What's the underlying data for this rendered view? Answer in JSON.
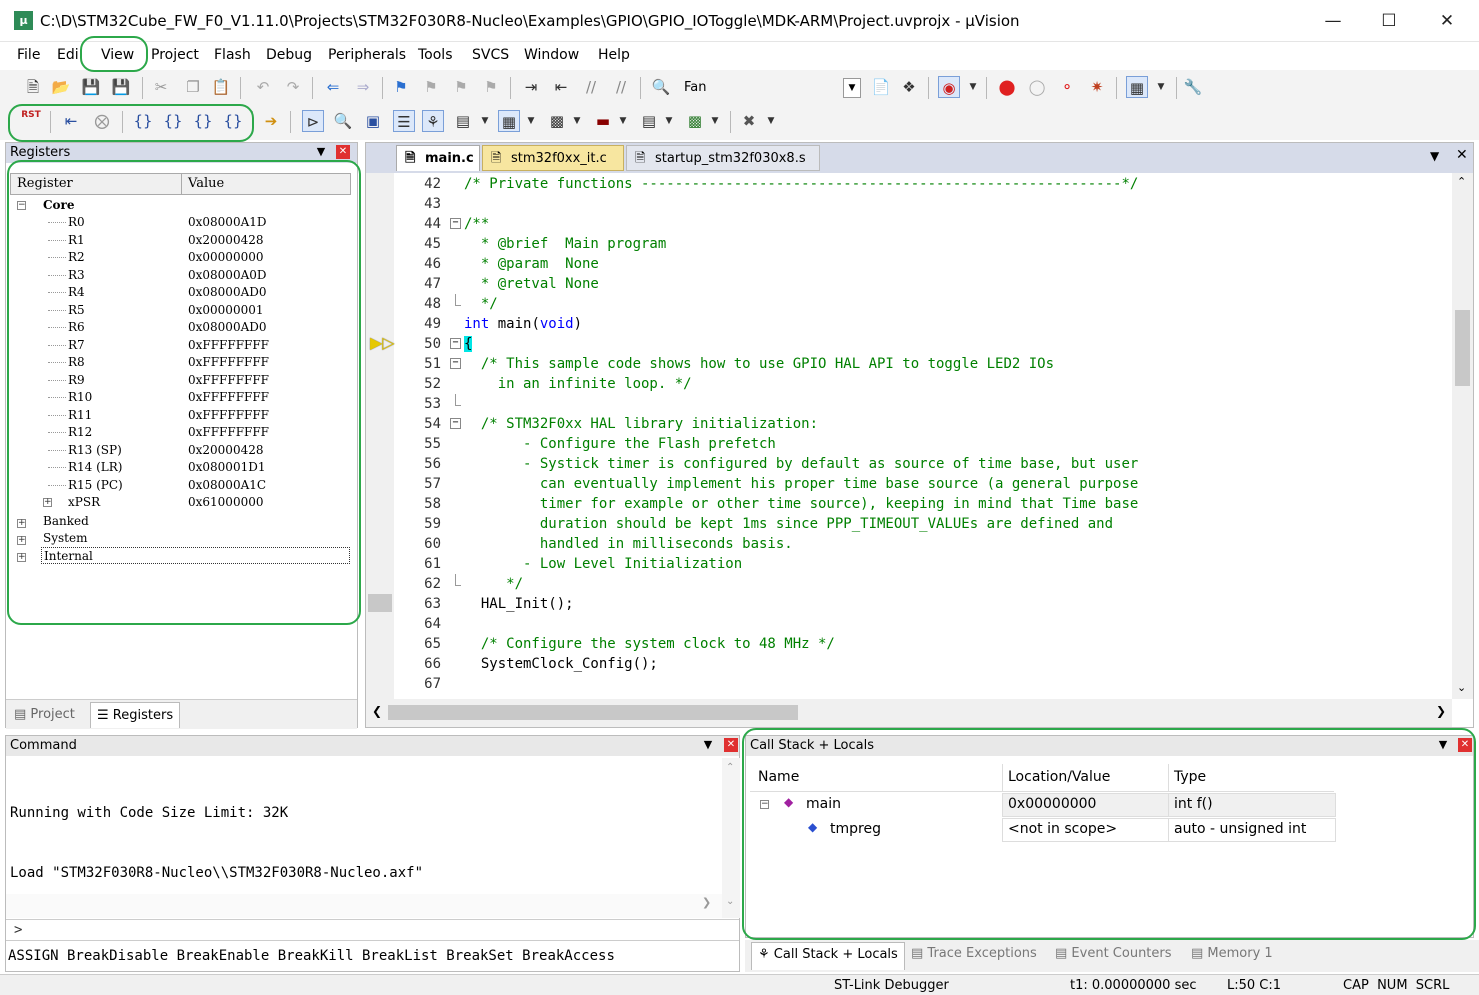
{
  "window": {
    "title": "C:\\D\\STM32Cube_FW_F0_V1.11.0\\Projects\\STM32F030R8-Nucleo\\Examples\\GPIO\\GPIO_IOToggle\\MDK-ARM\\Project.uvprojx - µVision"
  },
  "menu": [
    "File",
    "Edit",
    "View",
    "Project",
    "Flash",
    "Debug",
    "Peripherals",
    "Tools",
    "SVCS",
    "Window",
    "Help"
  ],
  "toolbar": {
    "target_name": "Fan",
    "rst_label": "RST"
  },
  "registers": {
    "title": "Registers",
    "col_register": "Register",
    "col_value": "Value",
    "core_label": "Core",
    "rows": [
      {
        "name": "R0",
        "value": "0x08000A1D"
      },
      {
        "name": "R1",
        "value": "0x20000428"
      },
      {
        "name": "R2",
        "value": "0x00000000"
      },
      {
        "name": "R3",
        "value": "0x08000A0D"
      },
      {
        "name": "R4",
        "value": "0x08000AD0"
      },
      {
        "name": "R5",
        "value": "0x00000001"
      },
      {
        "name": "R6",
        "value": "0x08000AD0"
      },
      {
        "name": "R7",
        "value": "0xFFFFFFFF"
      },
      {
        "name": "R8",
        "value": "0xFFFFFFFF"
      },
      {
        "name": "R9",
        "value": "0xFFFFFFFF"
      },
      {
        "name": "R10",
        "value": "0xFFFFFFFF"
      },
      {
        "name": "R11",
        "value": "0xFFFFFFFF"
      },
      {
        "name": "R12",
        "value": "0xFFFFFFFF"
      },
      {
        "name": "R13 (SP)",
        "value": "0x20000428"
      },
      {
        "name": "R14 (LR)",
        "value": "0x080001D1"
      },
      {
        "name": "R15 (PC)",
        "value": "0x08000A1C"
      },
      {
        "name": "xPSR",
        "value": "0x61000000"
      }
    ],
    "groups": [
      "Banked",
      "System",
      "Internal"
    ],
    "tab_project": "Project",
    "tab_registers": "Registers"
  },
  "editor": {
    "tabs": [
      "main.c",
      "stm32f0xx_it.c",
      "startup_stm32f030x8.s"
    ],
    "lines": [
      {
        "n": "42",
        "t": "/* Private functions ---------------------------------------------------------*/"
      },
      {
        "n": "43",
        "t": ""
      },
      {
        "n": "44",
        "t": "/**"
      },
      {
        "n": "45",
        "t": "  * @brief  Main program"
      },
      {
        "n": "46",
        "t": "  * @param  None"
      },
      {
        "n": "47",
        "t": "  * @retval None"
      },
      {
        "n": "48",
        "t": "  */"
      },
      {
        "n": "49",
        "t": "int main(void)"
      },
      {
        "n": "50",
        "t": "{"
      },
      {
        "n": "51",
        "t": "  /* This sample code shows how to use GPIO HAL API to toggle LED2 IOs"
      },
      {
        "n": "52",
        "t": "    in an infinite loop. */"
      },
      {
        "n": "53",
        "t": ""
      },
      {
        "n": "54",
        "t": "  /* STM32F0xx HAL library initialization:"
      },
      {
        "n": "55",
        "t": "       - Configure the Flash prefetch"
      },
      {
        "n": "56",
        "t": "       - Systick timer is configured by default as source of time base, but user"
      },
      {
        "n": "57",
        "t": "         can eventually implement his proper time base source (a general purpose"
      },
      {
        "n": "58",
        "t": "         timer for example or other time source), keeping in mind that Time base"
      },
      {
        "n": "59",
        "t": "         duration should be kept 1ms since PPP_TIMEOUT_VALUEs are defined and"
      },
      {
        "n": "60",
        "t": "         handled in milliseconds basis."
      },
      {
        "n": "61",
        "t": "       - Low Level Initialization"
      },
      {
        "n": "62",
        "t": "     */"
      },
      {
        "n": "63",
        "t": "  HAL_Init();"
      },
      {
        "n": "64",
        "t": ""
      },
      {
        "n": "65",
        "t": "  /* Configure the system clock to 48 MHz */"
      },
      {
        "n": "66",
        "t": "  SystemClock_Config();"
      },
      {
        "n": "67",
        "t": ""
      }
    ]
  },
  "command": {
    "title": "Command",
    "lines": [
      "Running with Code Size Limit: 32K",
      "Load \"STM32F030R8-Nucleo\\\\STM32F030R8-Nucleo.axf\""
    ],
    "prompt": ">",
    "hints": "ASSIGN BreakDisable BreakEnable BreakKill BreakList BreakSet BreakAccess"
  },
  "callstack": {
    "title": "Call Stack + Locals",
    "col_name": "Name",
    "col_loc": "Location/Value",
    "col_type": "Type",
    "rows": [
      {
        "name": "main",
        "loc": "0x00000000",
        "type": "int f()"
      },
      {
        "name": "tmpreg",
        "loc": "<not in scope>",
        "type": "auto - unsigned int"
      }
    ]
  },
  "bottom_tabs": [
    "Call Stack + Locals",
    "Trace Exceptions",
    "Event Counters",
    "Memory 1"
  ],
  "status": {
    "debugger": "ST-Link Debugger",
    "time": "t1: 0.00000000 sec",
    "pos": "L:50 C:1",
    "flags": "CAP  NUM  SCRL"
  }
}
